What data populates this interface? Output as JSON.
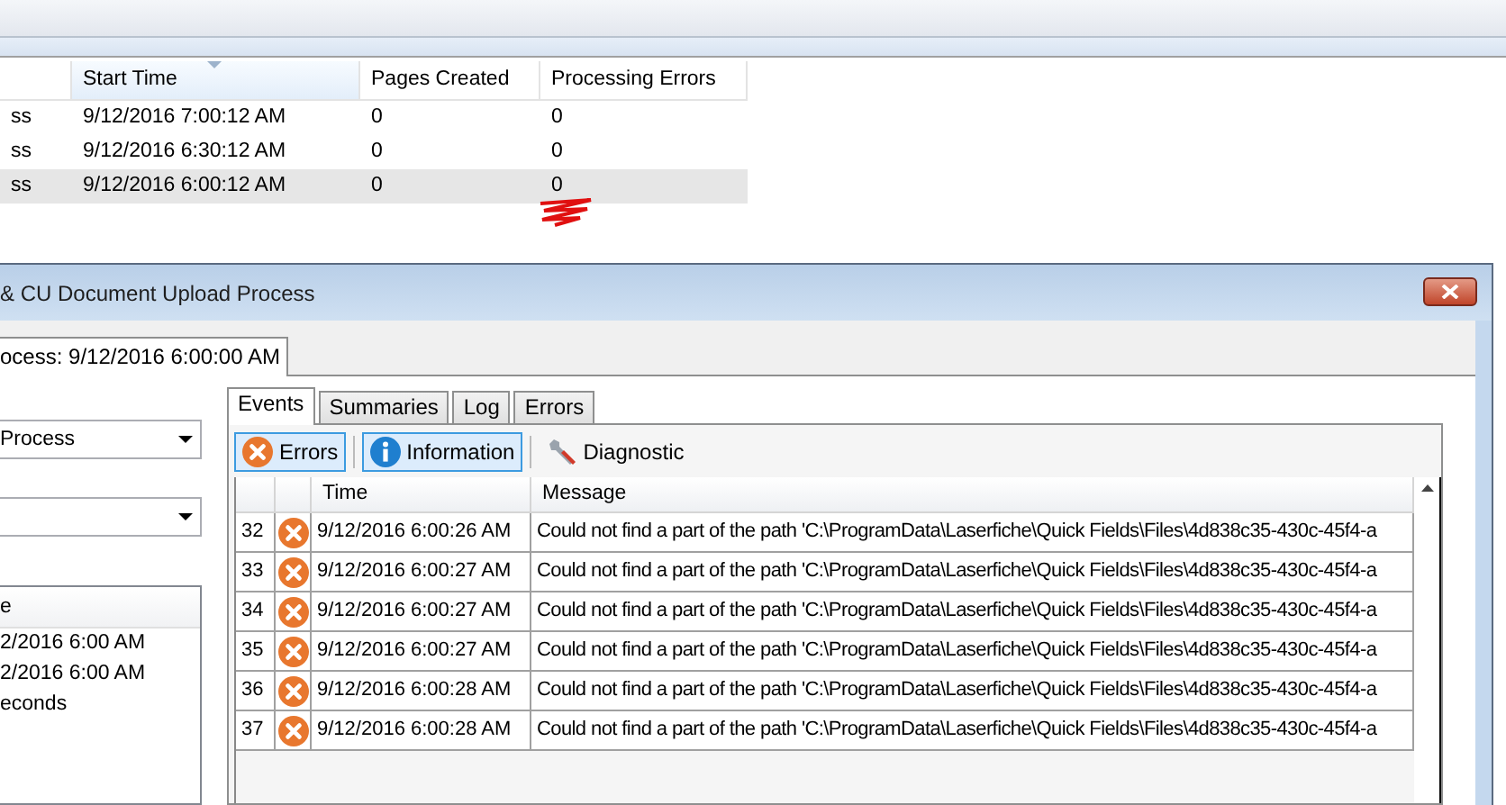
{
  "background_window": {
    "columns": [
      {
        "sorted": false
      },
      {
        "label": "Start Time",
        "sorted": true
      },
      {
        "label": "Pages Created",
        "sorted": false
      },
      {
        "label": "Processing Errors",
        "sorted": false
      }
    ],
    "rows": [
      {
        "cells": [
          "ss",
          "9/12/2016 7:00:12 AM",
          "0",
          "0"
        ],
        "selected": false
      },
      {
        "cells": [
          "ss",
          "9/12/2016 6:30:12 AM",
          "0",
          "0"
        ],
        "selected": false
      },
      {
        "cells": [
          "ss",
          "9/12/2016 6:00:12 AM",
          "0",
          "0"
        ],
        "selected": true
      }
    ]
  },
  "dialog": {
    "title": "& CU Document Upload Process",
    "run_tab": {
      "label": "ocess: 9/12/2016 6:00:00 AM",
      "selected": true
    },
    "process_combo": {
      "value": "Process"
    },
    "details_list": {
      "header": "e",
      "items": [
        "2/2016 6:00 AM",
        "2/2016 6:00 AM",
        "econds"
      ]
    },
    "tabs": [
      {
        "label": "Events",
        "selected": true
      },
      {
        "label": "Summaries",
        "selected": false
      },
      {
        "label": "Log",
        "selected": false
      },
      {
        "label": "Errors",
        "selected": false
      }
    ],
    "filters": [
      {
        "label": "Errors",
        "kind": "error",
        "checked": true
      },
      {
        "label": "Information",
        "kind": "info",
        "checked": true
      },
      {
        "label": "Diagnostic",
        "kind": "diagnostic",
        "checked": false
      }
    ],
    "events": {
      "columns": [
        "Time",
        "Message"
      ],
      "rows": [
        {
          "number": "32",
          "kind": "error",
          "time": "9/12/2016 6:00:26 AM",
          "message": "Could not find a part of the path 'C:\\ProgramData\\Laserfiche\\Quick Fields\\Files\\4d838c35-430c-45f4-a"
        },
        {
          "number": "33",
          "kind": "error",
          "time": "9/12/2016 6:00:27 AM",
          "message": "Could not find a part of the path 'C:\\ProgramData\\Laserfiche\\Quick Fields\\Files\\4d838c35-430c-45f4-a"
        },
        {
          "number": "34",
          "kind": "error",
          "time": "9/12/2016 6:00:27 AM",
          "message": "Could not find a part of the path 'C:\\ProgramData\\Laserfiche\\Quick Fields\\Files\\4d838c35-430c-45f4-a"
        },
        {
          "number": "35",
          "kind": "error",
          "time": "9/12/2016 6:00:27 AM",
          "message": "Could not find a part of the path 'C:\\ProgramData\\Laserfiche\\Quick Fields\\Files\\4d838c35-430c-45f4-a"
        },
        {
          "number": "36",
          "kind": "error",
          "time": "9/12/2016 6:00:28 AM",
          "message": "Could not find a part of the path 'C:\\ProgramData\\Laserfiche\\Quick Fields\\Files\\4d838c35-430c-45f4-a"
        },
        {
          "number": "37",
          "kind": "error",
          "time": "9/12/2016 6:00:28 AM",
          "message": "Could not find a part of the path 'C:\\ProgramData\\Laserfiche\\Quick Fields\\Files\\4d838c35-430c-45f4-a"
        }
      ]
    }
  }
}
